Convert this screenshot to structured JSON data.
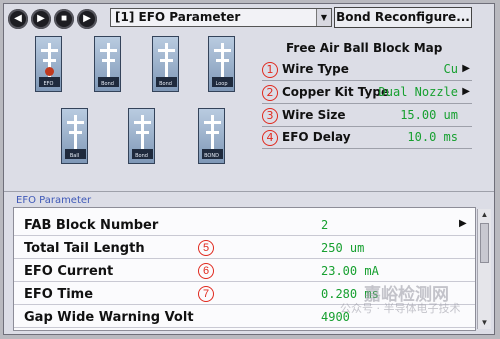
{
  "toolbar": {
    "nav": [
      {
        "name": "back",
        "glyph": "◀"
      },
      {
        "name": "forward",
        "glyph": "▶"
      },
      {
        "name": "stop",
        "glyph": "■"
      },
      {
        "name": "play",
        "glyph": "▶"
      }
    ],
    "dropdown_value": "[1] EFO Parameter",
    "dropdown_arrow": "▼",
    "bond_reconfigure_label": "Bond Reconfigure..."
  },
  "blocks": [
    {
      "label": "EFO",
      "selected": true
    },
    {
      "label": "Bond",
      "selected": false
    },
    {
      "label": "Bond",
      "selected": false
    },
    {
      "label": "Loop",
      "selected": false
    },
    {
      "label": "Ball",
      "selected": false
    },
    {
      "label": "Bond",
      "selected": false
    },
    {
      "label": "BOND",
      "selected": false
    }
  ],
  "block_map": {
    "title": "Free Air Ball Block Map",
    "items": [
      {
        "num": "1",
        "label": "Wire Type",
        "value": "Cu",
        "has_arrow": true
      },
      {
        "num": "2",
        "label": "Copper Kit Type",
        "value": "Dual Nozzle",
        "has_arrow": true
      },
      {
        "num": "3",
        "label": "Wire Size",
        "value": "15.00 um",
        "has_arrow": false
      },
      {
        "num": "4",
        "label": "EFO Delay",
        "value": "10.0 ms",
        "has_arrow": false
      }
    ]
  },
  "efo_panel": {
    "title": "EFO Parameter",
    "rows": [
      {
        "label": "FAB Block Number",
        "num": "",
        "value": "2",
        "has_arrow": true
      },
      {
        "label": "Total Tail Length",
        "num": "5",
        "value": "250 um",
        "has_arrow": false
      },
      {
        "label": "EFO Current",
        "num": "6",
        "value": "23.00 mA",
        "has_arrow": false
      },
      {
        "label": "EFO Time",
        "num": "7",
        "value": "0.280 ms",
        "has_arrow": false
      },
      {
        "label": "Gap Wide Warning Volt",
        "num": "",
        "value": "4900",
        "has_arrow": false
      }
    ]
  },
  "watermark": {
    "line1": "嘉峪检测网",
    "line2": "公众号 · 半导体电子技术"
  },
  "icons": {
    "scroll_up": "▲",
    "scroll_down": "▼",
    "row_arrow": "▶"
  },
  "colors": {
    "value_green": "#17a030",
    "callout_red": "#e02a1f",
    "panel_title_blue": "#3f59b8"
  }
}
